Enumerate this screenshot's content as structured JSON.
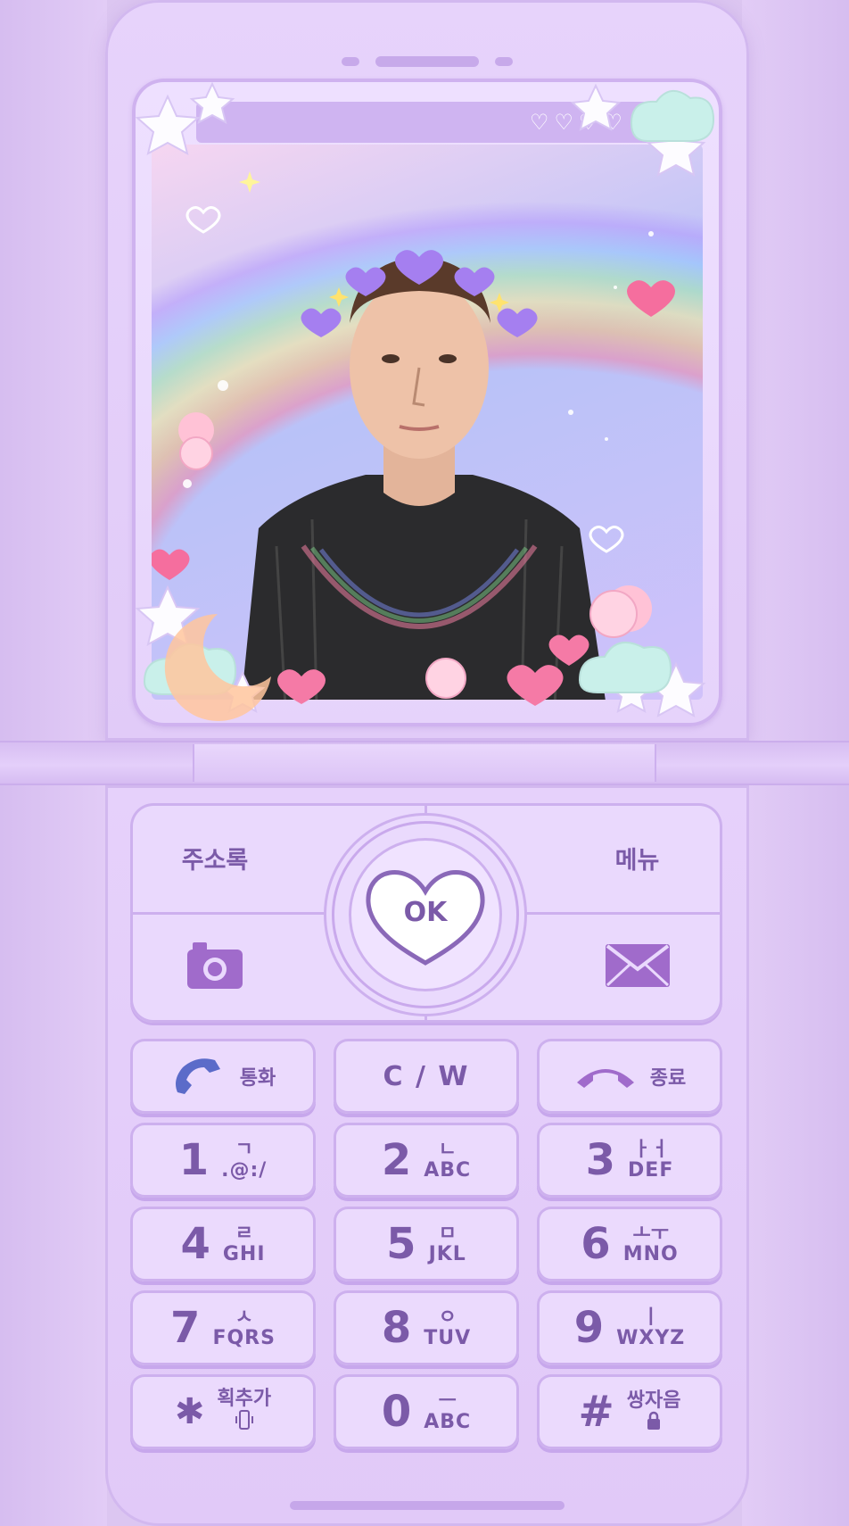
{
  "colors": {
    "body": "#e6d1fb",
    "key_text": "#7b5aa8",
    "key_border": "#cdb0ee",
    "call_icon": "#5b6bc9",
    "end_icon": "#a06bcb",
    "camera_icon": "#a06bcb",
    "mail_icon": "#a06bcb"
  },
  "screen": {
    "status_hearts": [
      "♡",
      "♡",
      "♡",
      "♡"
    ],
    "wallpaper_icon": "person-with-heart-crown-icon"
  },
  "nav": {
    "contacts_label": "주소록",
    "menu_label": "메뉴",
    "ok_label": "OK",
    "camera_icon": "camera-icon",
    "message_icon": "envelope-icon"
  },
  "function_keys": {
    "call": {
      "label": "통화",
      "icon": "phone-call-icon"
    },
    "clear": {
      "label": "C / W"
    },
    "end": {
      "label": "종료",
      "icon": "phone-end-icon"
    }
  },
  "keys": [
    {
      "digit": "1",
      "hangul": "ㄱ",
      "latin": ".@:/"
    },
    {
      "digit": "2",
      "hangul": "ㄴ",
      "latin": "ABC"
    },
    {
      "digit": "3",
      "hangul": "ㅏㅓ",
      "latin": "DEF"
    },
    {
      "digit": "4",
      "hangul": "ㄹ",
      "latin": "GHI"
    },
    {
      "digit": "5",
      "hangul": "ㅁ",
      "latin": "JKL"
    },
    {
      "digit": "6",
      "hangul": "ㅗㅜ",
      "latin": "MNO"
    },
    {
      "digit": "7",
      "hangul": "ㅅ",
      "latin": "FQRS"
    },
    {
      "digit": "8",
      "hangul": "ㅇ",
      "latin": "TUV"
    },
    {
      "digit": "9",
      "hangul": "ㅣ",
      "latin": "WXYZ"
    },
    {
      "digit": "✱",
      "hangul": "획추가",
      "latin": "",
      "icon": "phone-vibrate-icon"
    },
    {
      "digit": "0",
      "hangul": "ㅡ",
      "latin": "ABC"
    },
    {
      "digit": "#",
      "hangul": "쌍자음",
      "latin": "",
      "icon": "lock-icon"
    }
  ]
}
